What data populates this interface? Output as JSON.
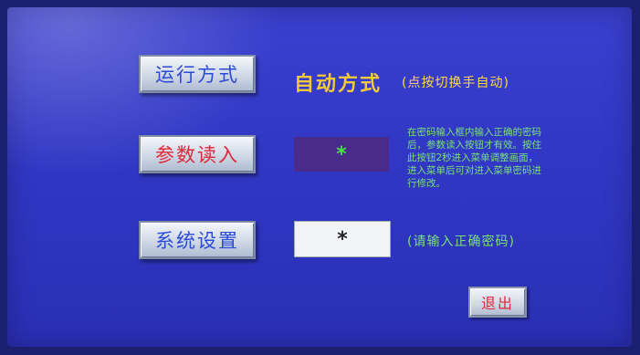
{
  "run_mode": {
    "button_label": "运行方式",
    "current_mode": "自动方式",
    "hint": "(点按切换手自动)"
  },
  "param_load": {
    "button_label": "参数读入",
    "password_mask": "*",
    "info_text": "在密码输入框内输入正确的密码后，参数读入按钮才有效。按住此按钮2秒进入菜单调整画面，进入菜单后可对进入菜单密码进行修改。"
  },
  "system_settings": {
    "button_label": "系统设置",
    "password_mask": "*",
    "hint": "(请输入正确密码)"
  },
  "exit": {
    "button_label": "退出"
  },
  "colors": {
    "background": "#3137c4",
    "mode_text": "#f2c93a",
    "hint_green": "#78e07a",
    "button_red_text": "#e0283a",
    "button_blue_text": "#2c4ad8"
  }
}
